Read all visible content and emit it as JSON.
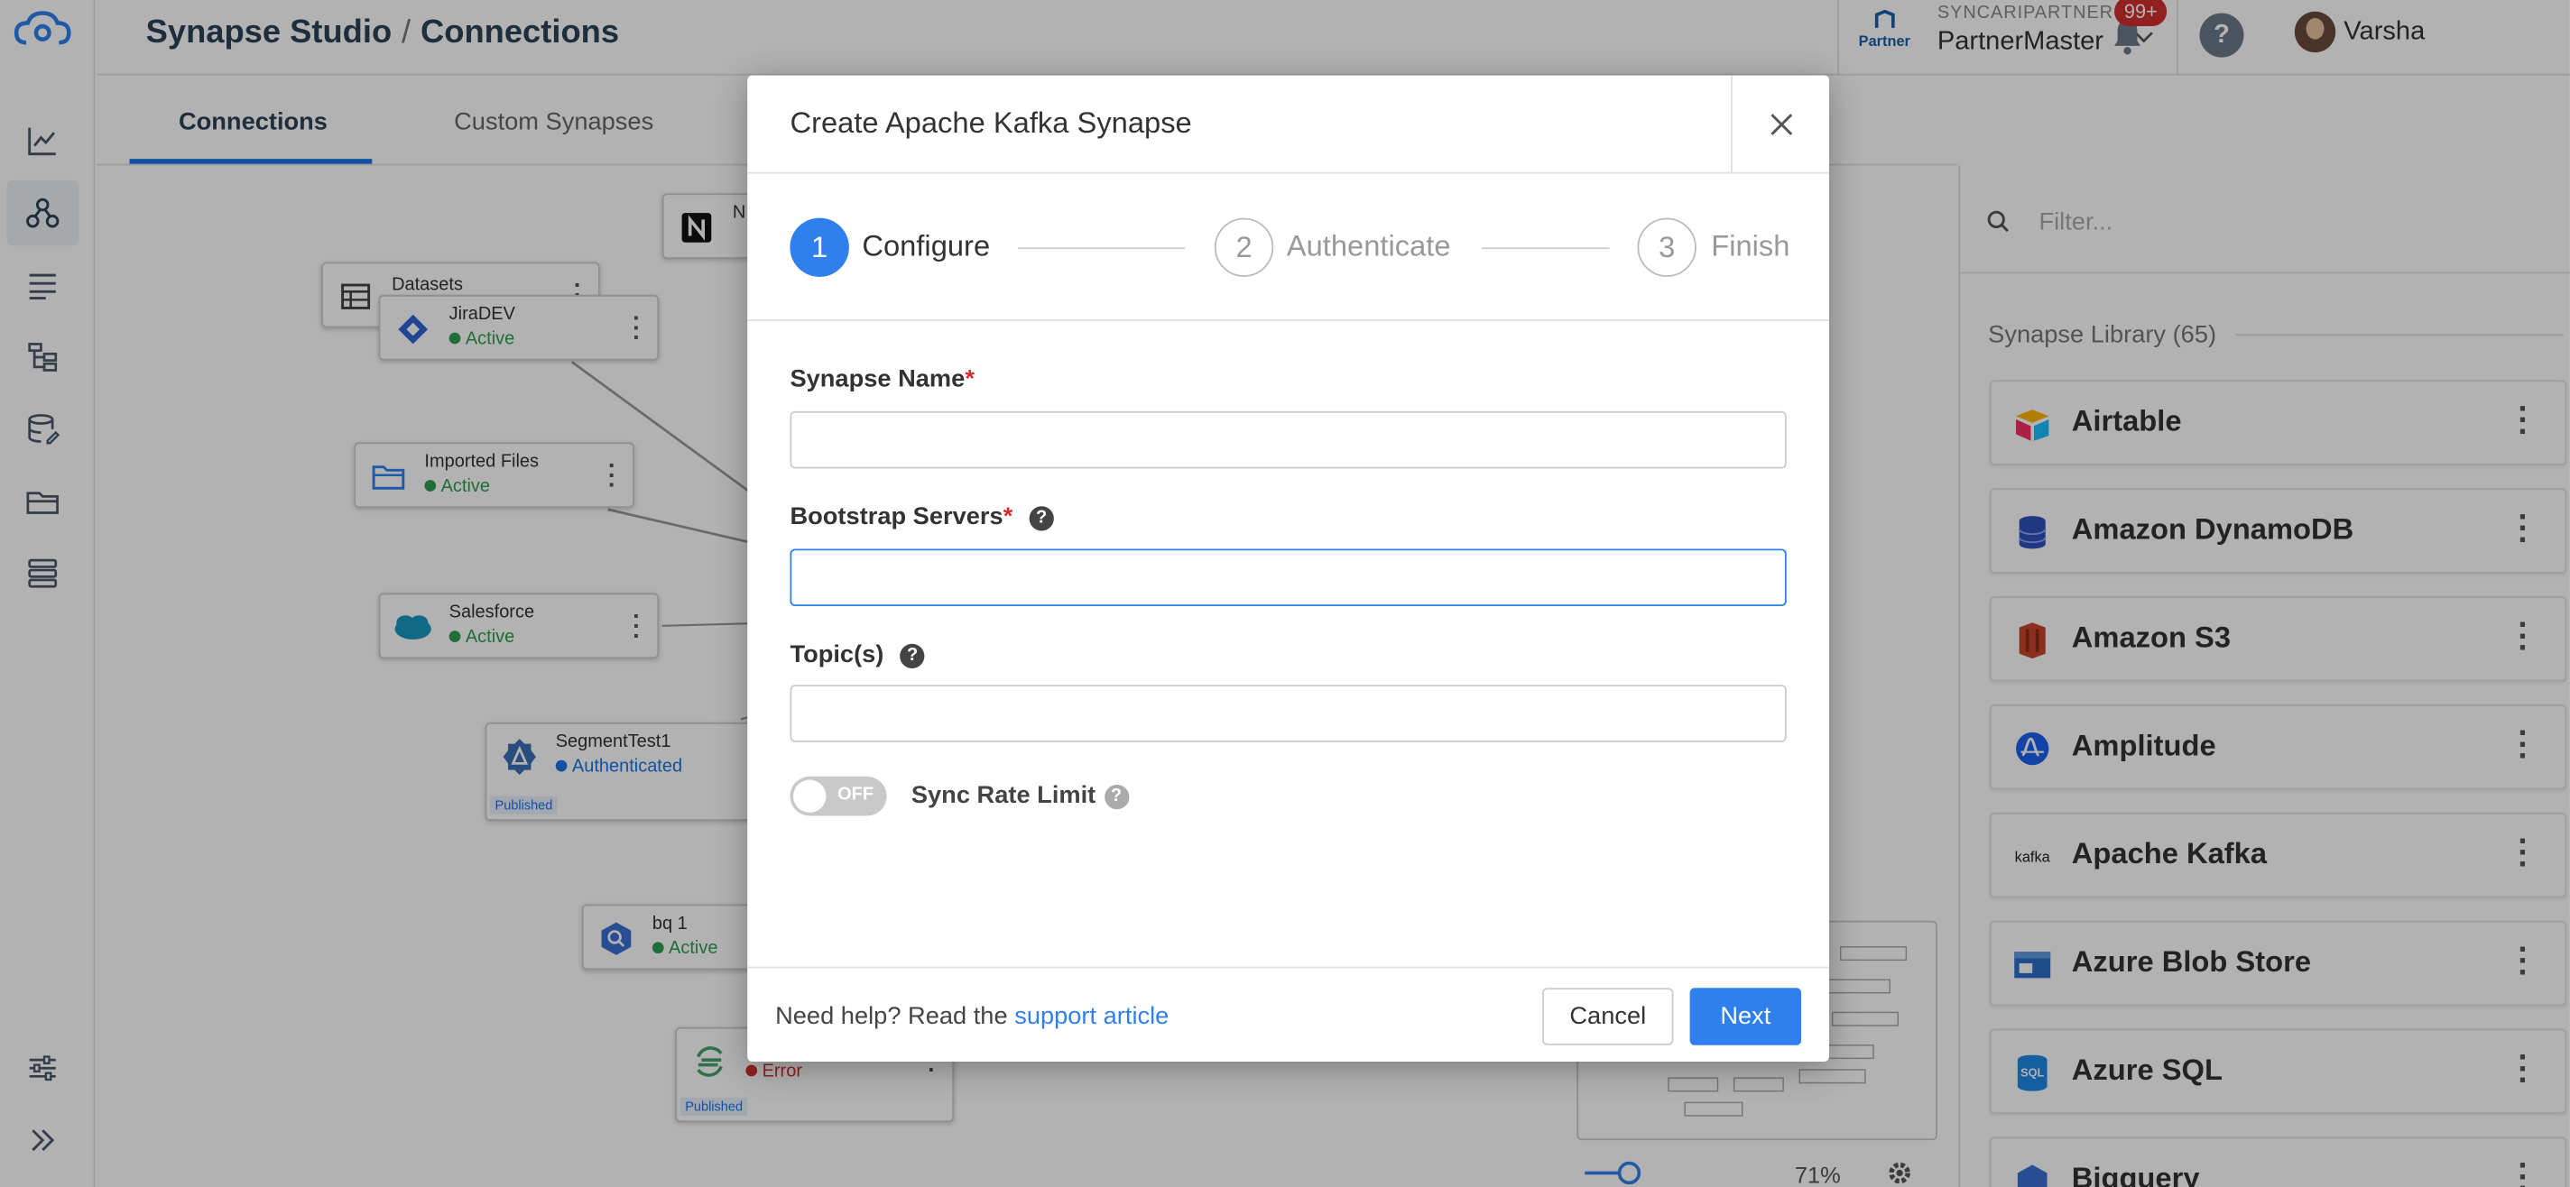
{
  "header": {
    "breadcrumb_app": "Synapse Studio",
    "breadcrumb_sep": "/",
    "breadcrumb_page": "Connections"
  },
  "org": {
    "logo_text": "Partner",
    "name": "SYNCARIPARTNER",
    "user": "PartnerMaster"
  },
  "notifications": {
    "count": "99+"
  },
  "user": {
    "name": "Varsha",
    "help": "?"
  },
  "tabs": [
    {
      "label": "Connections",
      "active": true
    },
    {
      "label": "Custom Synapses",
      "active": false
    }
  ],
  "canvas": {
    "nodes": [
      {
        "name": "N",
        "status": ""
      },
      {
        "name": "Datasets",
        "status": ""
      },
      {
        "name": "JiraDEV",
        "status": "Active"
      },
      {
        "name": "Imported Files",
        "status": "Active"
      },
      {
        "name": "Salesforce",
        "status": "Active"
      },
      {
        "name": "SegmentTest1",
        "status": "Authenticated",
        "tag": "Published"
      },
      {
        "name": "bq 1",
        "status": "Active"
      },
      {
        "name": "",
        "status": "Error",
        "tag": "Published"
      }
    ],
    "zoom": "71%"
  },
  "library": {
    "filter_placeholder": "Filter...",
    "heading": "Synapse Library (65)",
    "items": [
      {
        "label": "Airtable",
        "icon": "airtable-icon"
      },
      {
        "label": "Amazon DynamoDB",
        "icon": "dynamodb-icon"
      },
      {
        "label": "Amazon S3",
        "icon": "s3-icon"
      },
      {
        "label": "Amplitude",
        "icon": "amplitude-icon"
      },
      {
        "label": "Apache Kafka",
        "icon": "kafka-icon",
        "icon_text": "kafka"
      },
      {
        "label": "Azure Blob Store",
        "icon": "azure-blob-icon"
      },
      {
        "label": "Azure SQL",
        "icon": "azure-sql-icon",
        "icon_text": "SQL"
      },
      {
        "label": "Bigquery",
        "icon": "bigquery-icon"
      }
    ]
  },
  "modal": {
    "title": "Create Apache Kafka Synapse",
    "steps": [
      {
        "num": "1",
        "label": "Configure",
        "active": true
      },
      {
        "num": "2",
        "label": "Authenticate",
        "active": false
      },
      {
        "num": "3",
        "label": "Finish",
        "active": false
      }
    ],
    "fields": {
      "synapse_name": {
        "label": "Synapse Name",
        "required": "*",
        "value": ""
      },
      "bootstrap_servers": {
        "label": "Bootstrap Servers",
        "required": "*",
        "value": ""
      },
      "topics": {
        "label": "Topic(s)",
        "value": ""
      }
    },
    "toggle": {
      "state": "OFF",
      "label": "Sync Rate Limit"
    },
    "footer": {
      "help_prefix": "Need help? Read the",
      "help_link": "support article",
      "cancel": "Cancel",
      "next": "Next"
    }
  },
  "colors": {
    "primary": "#2f80ed",
    "active_status": "#2e9e4f",
    "error": "#d32f2f",
    "nav_title": "#2d4356"
  }
}
